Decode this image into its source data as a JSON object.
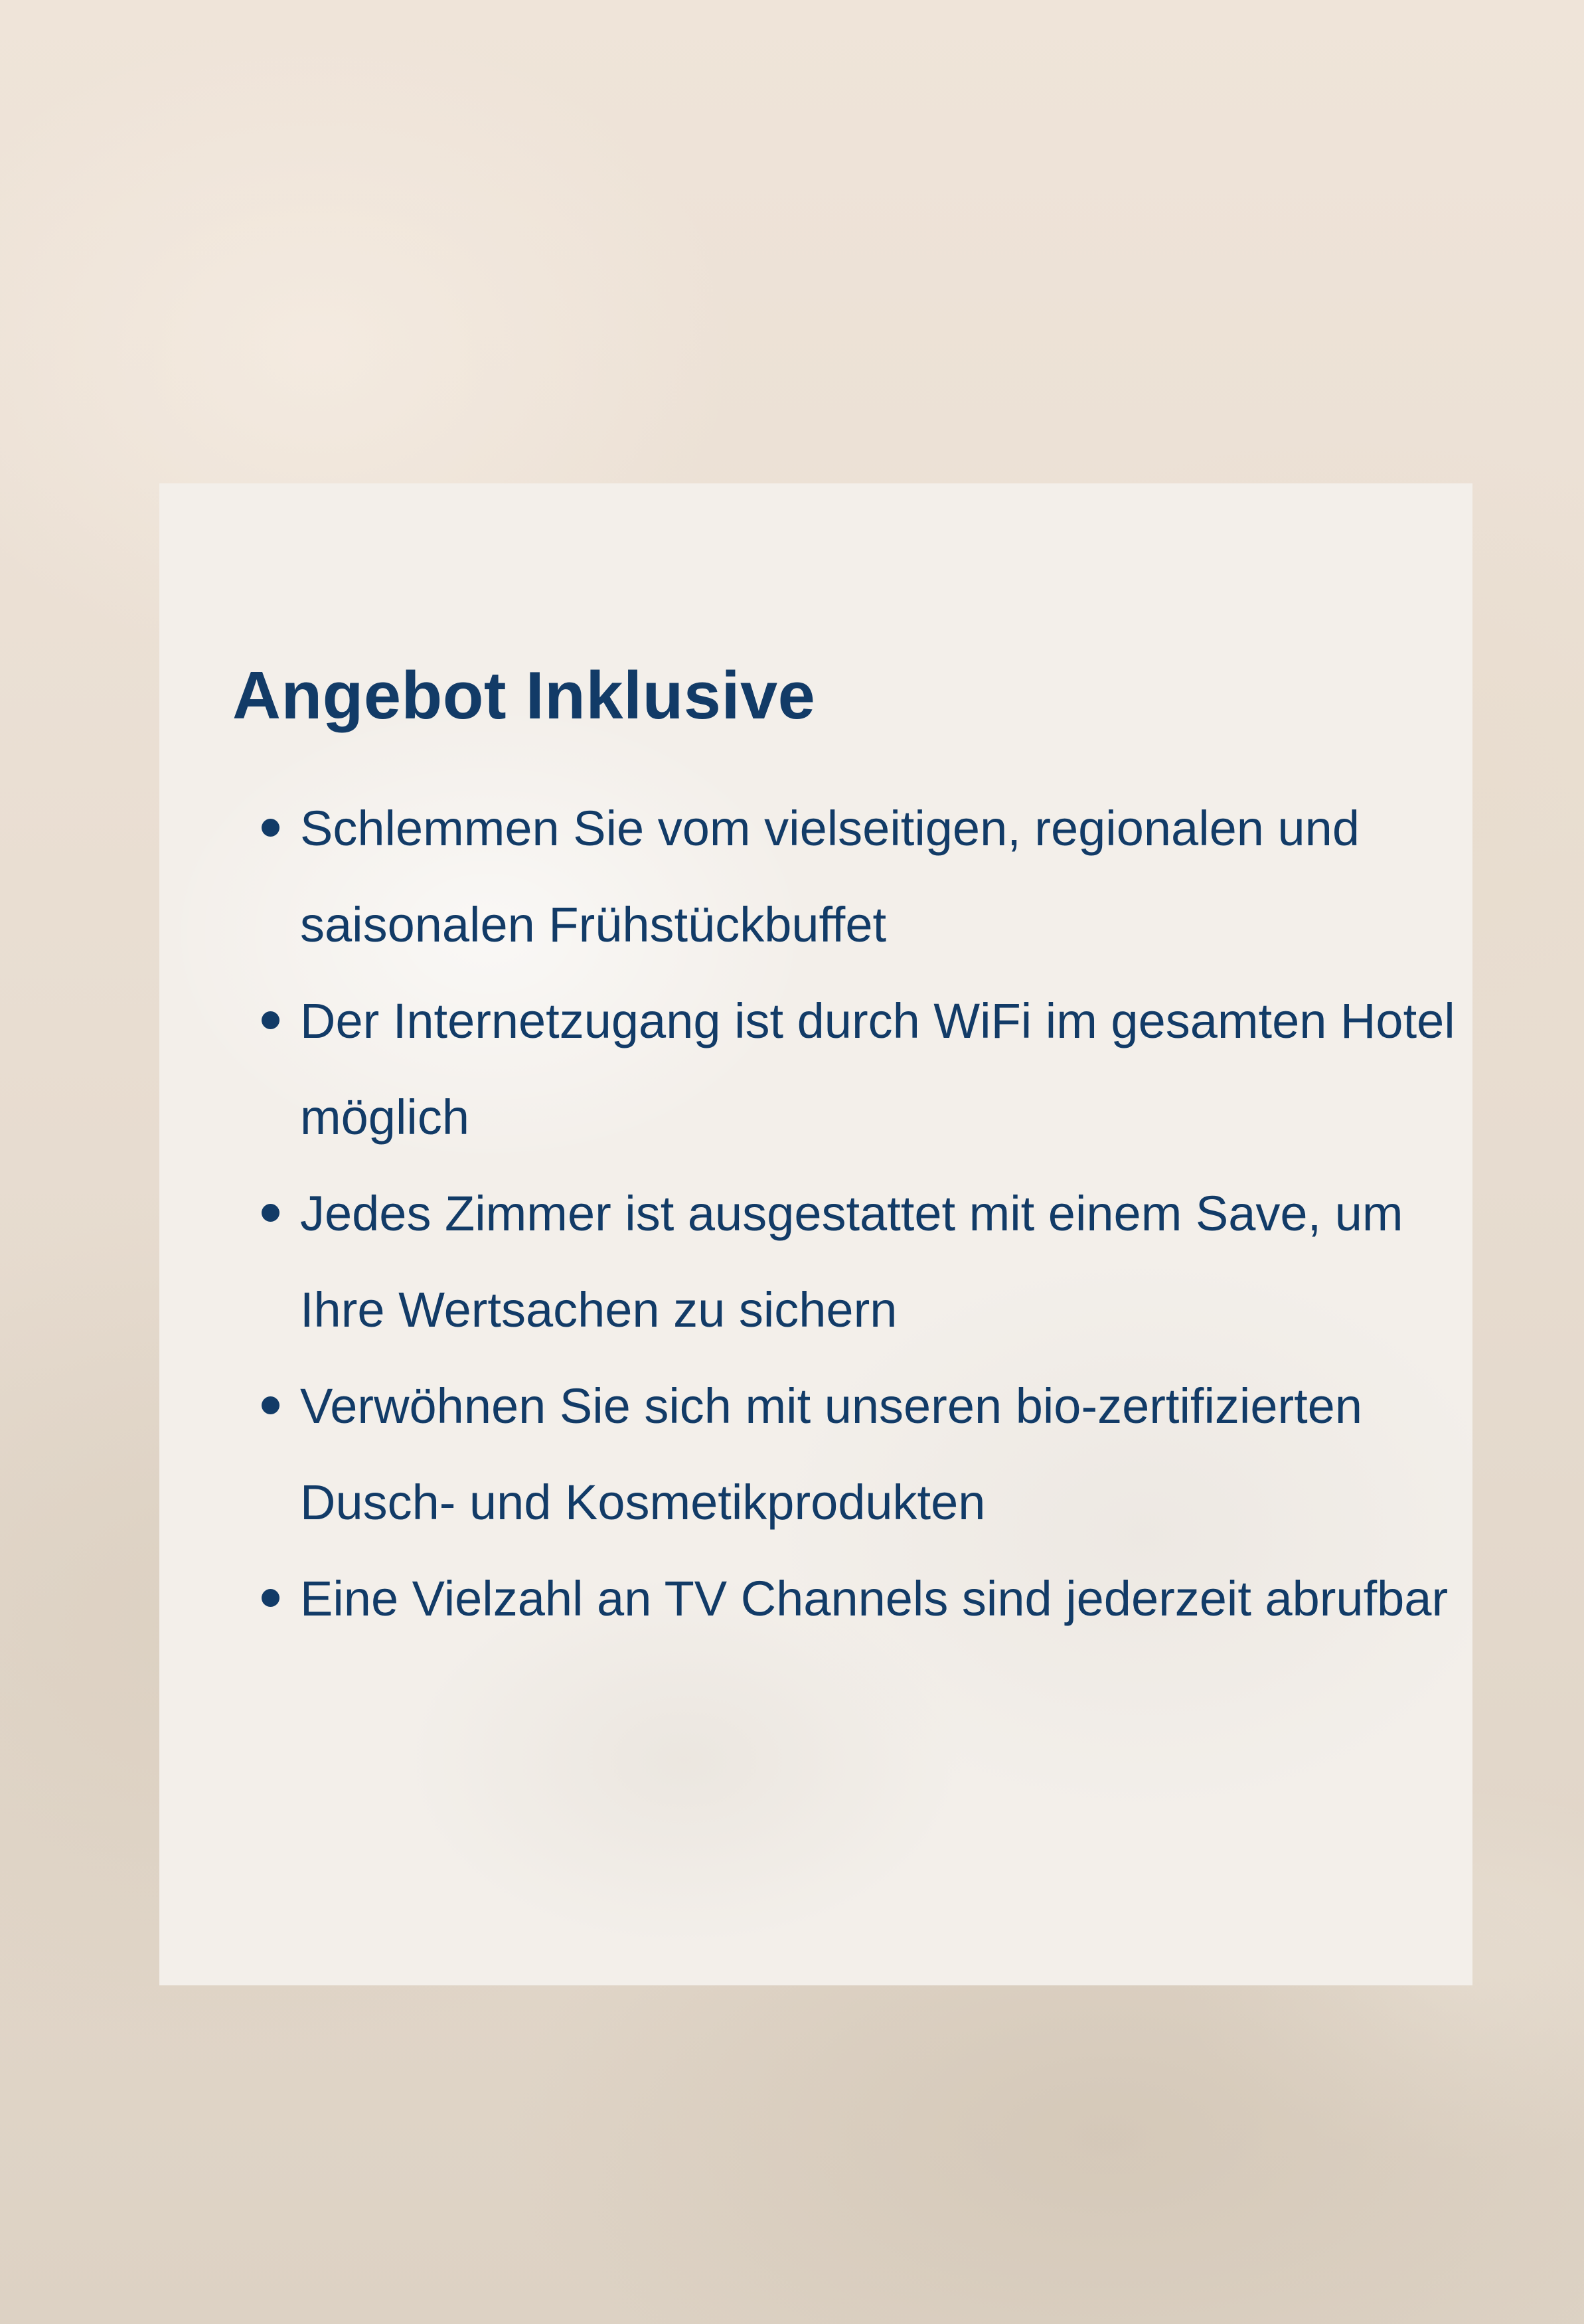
{
  "title": "Angebot Inklusive",
  "features": [
    "Schlemmen Sie vom vielseitigen, regionalen und saisonalen Frühstückbuffet",
    "Der Internetzugang ist durch WiFi im gesamten Hotel möglich",
    "Jedes Zimmer ist ausgestattet mit einem Save, um Ihre Wertsachen zu sichern",
    "Verwöhnen Sie sich mit unseren bio-zertifizierten Dusch- und Kosmetikprodukten",
    "Eine Vielzahl an TV Channels sind jederzeit abrufbar"
  ],
  "colors": {
    "text": "#123b67",
    "card": "#f3efea",
    "background": "#e7dbcf"
  }
}
